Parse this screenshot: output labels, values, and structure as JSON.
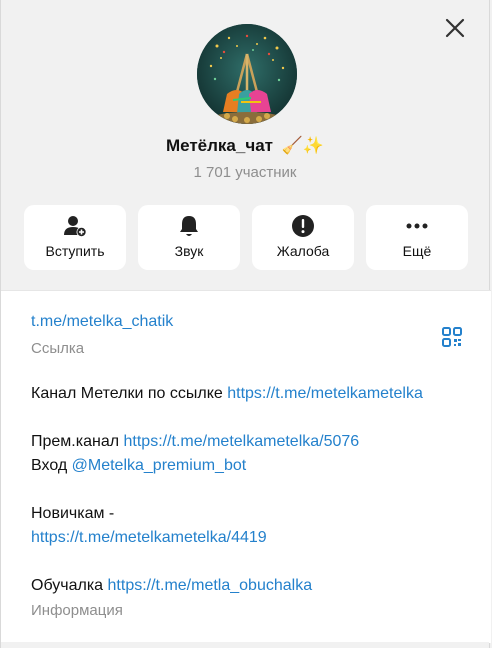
{
  "header": {
    "title": "Метёлка_чат",
    "title_emoji": "🧹✨",
    "subtitle": "1 701 участник"
  },
  "actions": [
    {
      "label": "Вступить",
      "icon": "add-user-icon"
    },
    {
      "label": "Звук",
      "icon": "bell-icon"
    },
    {
      "label": "Жалоба",
      "icon": "warning-icon"
    },
    {
      "label": "Ещё",
      "icon": "more-icon"
    }
  ],
  "info": {
    "link": "t.me/metelka_chatik",
    "link_caption": "Ссылка",
    "desc_line1_text": "Канал Метелки  по ссылке ",
    "desc_line1_link": "https://t.me/metelkametelka",
    "desc_line2_text": "Прем.канал ",
    "desc_line2_link": "https://t.me/metelkametelka/5076",
    "desc_line3_text": "Вход ",
    "desc_line3_link": "@Metelka_premium_bot",
    "desc_line4_text": "Новичкам -",
    "desc_line5_link": "https://t.me/metelkametelka/4419",
    "desc_line6_text": "Обучалка ",
    "desc_line6_link": "https://t.me/metla_obuchalka",
    "info_caption": "Информация"
  },
  "colors": {
    "accent": "#2481cc",
    "muted": "#8e8e8e",
    "background": "#f1f1f1"
  }
}
